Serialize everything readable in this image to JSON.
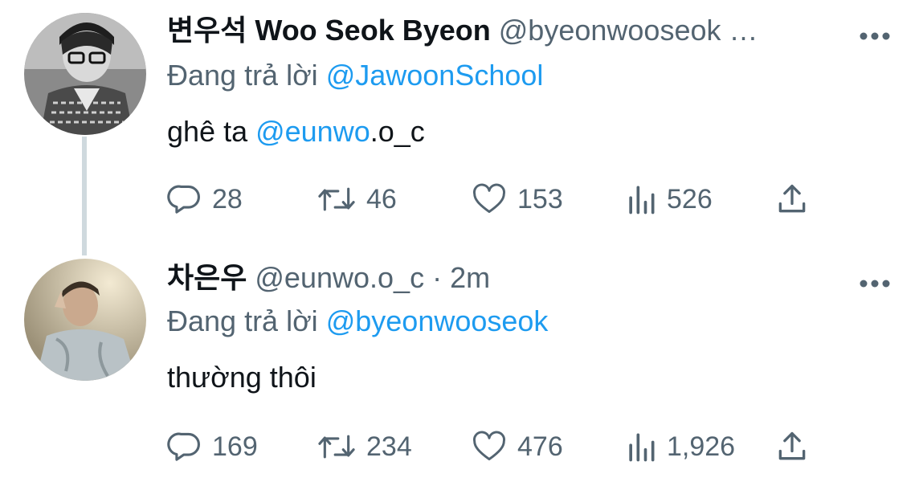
{
  "tweets": [
    {
      "display_name": "변우석 Woo Seok Byeon",
      "handle": "@byeonwooseok …",
      "reply_prefix": "Đang trả lời",
      "reply_to": "@JawoonSchool",
      "body_mention": "@eunwo",
      "body_prefix": "ghê ta ",
      "body_suffix": ".o_c",
      "counts": {
        "replies": "28",
        "retweets": "46",
        "likes": "153",
        "views": "526"
      }
    },
    {
      "display_name": "차은우",
      "handle": "@eunwo.o_c",
      "separator": "·",
      "time": "2m",
      "reply_prefix": "Đang trả lời",
      "reply_to": "@byeonwooseok",
      "body": "thường thôi",
      "counts": {
        "replies": "169",
        "retweets": "234",
        "likes": "476",
        "views": "1,926"
      }
    }
  ],
  "icons": {
    "reply": "reply-icon",
    "retweet": "retweet-icon",
    "like": "heart-icon",
    "views": "views-icon",
    "share": "share-icon",
    "more": "more-icon"
  },
  "colors": {
    "link": "#1d9bf0",
    "secondary_text": "#536471",
    "primary_text": "#0f1419",
    "thread_line": "#cfd9de"
  }
}
